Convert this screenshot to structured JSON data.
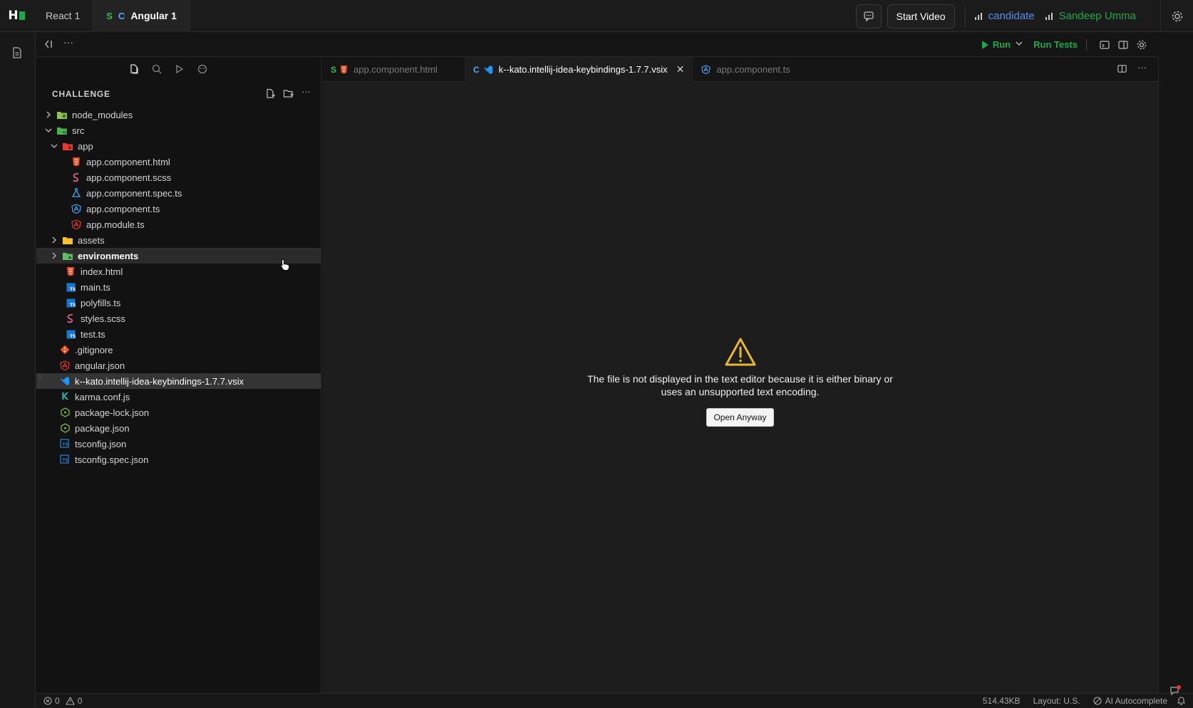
{
  "top_tabs": [
    {
      "label": "React 1",
      "prefix_s": "",
      "prefix_c": ""
    },
    {
      "label": "Angular 1",
      "prefix_s": "S",
      "prefix_c": "C"
    }
  ],
  "header": {
    "start_video": "Start Video",
    "role": "candidate",
    "user": "Sandeep Umma"
  },
  "toolbar": {
    "run": "Run",
    "run_tests": "Run Tests"
  },
  "explorer": {
    "title": "CHALLENGE",
    "tree": [
      {
        "name": "node_modules",
        "icon": "folder-node-icon"
      },
      {
        "name": "src",
        "icon": "folder-src-icon"
      },
      {
        "name": "app",
        "icon": "folder-app-icon"
      },
      {
        "name": "app.component.html",
        "icon": "html-file-icon"
      },
      {
        "name": "app.component.scss",
        "icon": "scss-file-icon"
      },
      {
        "name": "app.component.spec.ts",
        "icon": "test-file-icon"
      },
      {
        "name": "app.component.ts",
        "icon": "angular-component-icon"
      },
      {
        "name": "app.module.ts",
        "icon": "angular-module-icon"
      },
      {
        "name": "assets",
        "icon": "folder-assets-icon"
      },
      {
        "name": "environments",
        "icon": "folder-env-icon"
      },
      {
        "name": "index.html",
        "icon": "html-file-icon"
      },
      {
        "name": "main.ts",
        "icon": "ts-file-icon"
      },
      {
        "name": "polyfills.ts",
        "icon": "ts-file-icon"
      },
      {
        "name": "styles.scss",
        "icon": "scss-file-icon"
      },
      {
        "name": "test.ts",
        "icon": "ts-file-icon"
      },
      {
        "name": ".gitignore",
        "icon": "git-icon"
      },
      {
        "name": "angular.json",
        "icon": "angular-icon"
      },
      {
        "name": "k--kato.intellij-idea-keybindings-1.7.7.vsix",
        "icon": "vscode-icon"
      },
      {
        "name": "karma.conf.js",
        "icon": "karma-icon"
      },
      {
        "name": "package-lock.json",
        "icon": "npm-icon"
      },
      {
        "name": "package.json",
        "icon": "npm-icon"
      },
      {
        "name": "tsconfig.json",
        "icon": "tsconfig-icon"
      },
      {
        "name": "tsconfig.spec.json",
        "icon": "tsconfig-icon"
      }
    ]
  },
  "editor_tabs": [
    {
      "prefix": "S",
      "label": "app.component.html"
    },
    {
      "prefix": "C",
      "label": "k--kato.intellij-idea-keybindings-1.7.7.vsix"
    },
    {
      "prefix": "",
      "label": "app.component.ts"
    }
  ],
  "editor": {
    "message_line1": "The file is not displayed in the text editor because it is either binary or",
    "message_line2": "uses an unsupported text encoding.",
    "open_anyway": "Open Anyway"
  },
  "status": {
    "errors": "0",
    "warnings": "0",
    "size": "514.43KB",
    "layout": "Layout: U.S.",
    "ai": "AI Autocomplete"
  },
  "colors": {
    "accent_green": "#1ba94c",
    "accent_blue": "#5b8def",
    "warning_yellow": "#e8b72f"
  }
}
